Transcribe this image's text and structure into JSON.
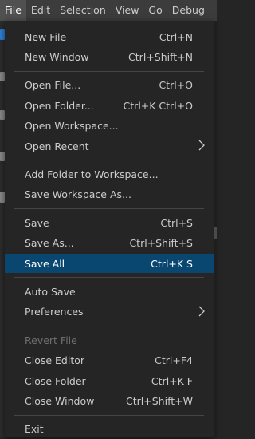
{
  "menubar": {
    "items": [
      {
        "label": "File",
        "active": true
      },
      {
        "label": "Edit"
      },
      {
        "label": "Selection"
      },
      {
        "label": "View"
      },
      {
        "label": "Go"
      },
      {
        "label": "Debug"
      }
    ]
  },
  "file_menu": {
    "groups": [
      [
        {
          "label": "New File",
          "shortcut": "Ctrl+N"
        },
        {
          "label": "New Window",
          "shortcut": "Ctrl+Shift+N"
        }
      ],
      [
        {
          "label": "Open File...",
          "shortcut": "Ctrl+O"
        },
        {
          "label": "Open Folder...",
          "shortcut": "Ctrl+K Ctrl+O"
        },
        {
          "label": "Open Workspace...",
          "shortcut": ""
        },
        {
          "label": "Open Recent",
          "shortcut": "",
          "submenu": true
        }
      ],
      [
        {
          "label": "Add Folder to Workspace...",
          "shortcut": ""
        },
        {
          "label": "Save Workspace As...",
          "shortcut": ""
        }
      ],
      [
        {
          "label": "Save",
          "shortcut": "Ctrl+S"
        },
        {
          "label": "Save As...",
          "shortcut": "Ctrl+Shift+S"
        },
        {
          "label": "Save All",
          "shortcut": "Ctrl+K S",
          "highlighted": true
        }
      ],
      [
        {
          "label": "Auto Save",
          "shortcut": ""
        },
        {
          "label": "Preferences",
          "shortcut": "",
          "submenu": true
        }
      ],
      [
        {
          "label": "Revert File",
          "shortcut": "",
          "disabled": true
        },
        {
          "label": "Close Editor",
          "shortcut": "Ctrl+F4"
        },
        {
          "label": "Close Folder",
          "shortcut": "Ctrl+K F"
        },
        {
          "label": "Close Window",
          "shortcut": "Ctrl+Shift+W"
        }
      ],
      [
        {
          "label": "Exit",
          "shortcut": ""
        }
      ]
    ]
  },
  "colors": {
    "menubar_bg": "#3c3c3c",
    "menu_bg": "#252526",
    "highlight_bg": "#094771",
    "text": "#cccccc",
    "disabled_text": "#6f6f6f",
    "separator": "#454545"
  }
}
